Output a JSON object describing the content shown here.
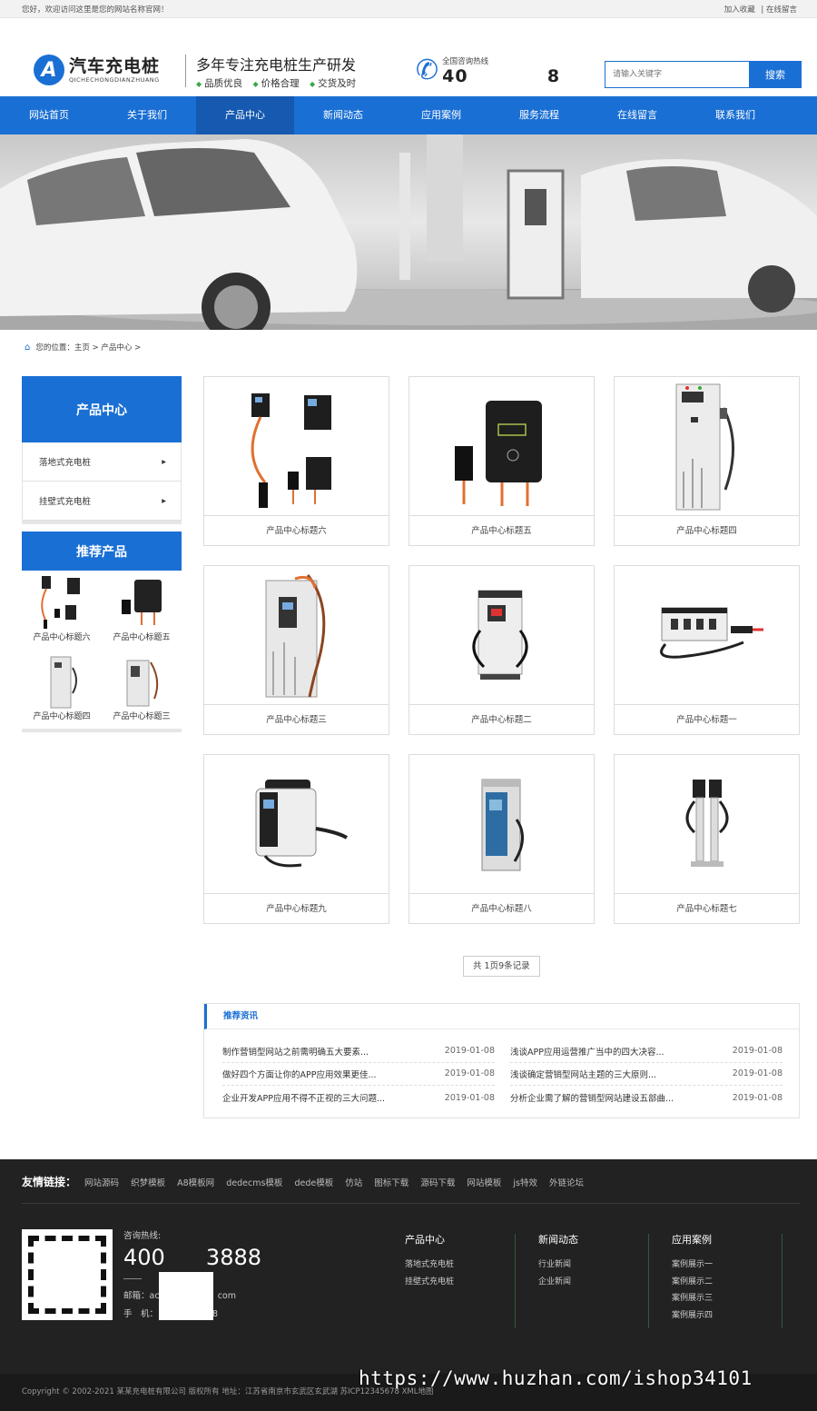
{
  "topbar": {
    "welcome": "您好，欢迎访问这里是您的网站名称官网！",
    "fav": "加入收藏",
    "sep": "|",
    "msg": "在线留言"
  },
  "logo": {
    "mark": "A",
    "cn": "汽车充电桩",
    "en": "QICHECHONGDIANZHUANG"
  },
  "slogan": {
    "title": "多年专注充电桩生产研发",
    "features": [
      "品质优良",
      "价格合理",
      "交货及时"
    ]
  },
  "hotline": {
    "label": "全国咨询热线",
    "number": "40",
    "number_tail": "8"
  },
  "search": {
    "placeholder": "请输入关键字",
    "button": "搜索"
  },
  "nav": [
    "网站首页",
    "关于我们",
    "产品中心",
    "新闻动态",
    "应用案例",
    "服务流程",
    "在线留言",
    "联系我们"
  ],
  "nav_active": "产品中心",
  "breadcrumb": {
    "text": "您的位置：主页 > 产品中心 >"
  },
  "sidebar": {
    "title": "产品中心",
    "categories": [
      "落地式充电桩",
      "挂壁式充电桩"
    ],
    "rec_title": "推荐产品",
    "rec_items": [
      "产品中心标题六",
      "产品中心标题五",
      "产品中心标题四",
      "产品中心标题三"
    ]
  },
  "products": [
    "产品中心标题六",
    "产品中心标题五",
    "产品中心标题四",
    "产品中心标题三",
    "产品中心标题二",
    "产品中心标题一",
    "产品中心标题九",
    "产品中心标题八",
    "产品中心标题七"
  ],
  "pager": "共 1页9条记录",
  "news": {
    "title": "推荐资讯",
    "items": [
      {
        "t": "制作营销型网站之前需明确五大要素...",
        "d": "2019-01-08"
      },
      {
        "t": "浅谈APP应用运营推广当中的四大决容...",
        "d": "2019-01-08"
      },
      {
        "t": "做好四个方面让你的APP应用效果更佳...",
        "d": "2019-01-08"
      },
      {
        "t": "浅谈确定营销型网站主题的三大原则...",
        "d": "2019-01-08"
      },
      {
        "t": "企业开发APP应用不得不正视的三大问题...",
        "d": "2019-01-08"
      },
      {
        "t": "分析企业需了解的营销型网站建设五部曲...",
        "d": "2019-01-08"
      }
    ]
  },
  "footer": {
    "links_label": "友情链接：",
    "links": [
      "网站源码",
      "织梦模板",
      "A8模板网",
      "dedecms模板",
      "dede模板",
      "仿站",
      "图标下载",
      "源码下载",
      "网站模板",
      "js特效",
      "外链论坛"
    ],
    "hotline_label": "咨询热线:",
    "hotline": "400",
    "hotline_tail": "3888",
    "email": "邮箱：ac",
    "email_tail": "com",
    "mobile": "手　机：",
    "mobile_tail": "8",
    "cols": [
      {
        "h": "产品中心",
        "items": [
          "落地式充电桩",
          "挂壁式充电桩"
        ]
      },
      {
        "h": "新闻动态",
        "items": [
          "行业新闻",
          "企业新闻"
        ]
      },
      {
        "h": "应用案例",
        "items": [
          "案例展示一",
          "案例展示二",
          "案例展示三",
          "案例展示四"
        ]
      }
    ],
    "copyright": "Copyright © 2002-2021 某某充电桩有限公司 版权所有    地址：江苏省南京市玄武区玄武湖    苏ICP12345678    XML地图"
  },
  "watermark": "https://www.huzhan.com/ishop34101",
  "colors": {
    "accent": "#1a6fd4",
    "footer": "#222222"
  }
}
